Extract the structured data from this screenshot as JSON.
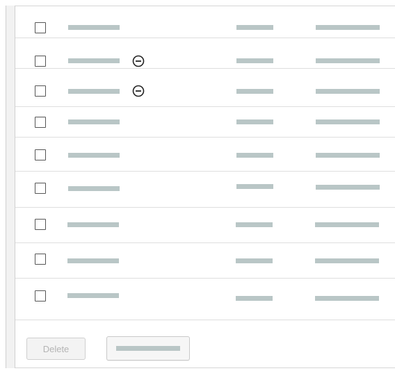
{
  "table": {
    "rows": [
      {
        "checked": false,
        "has_remove_icon": false
      },
      {
        "checked": false,
        "has_remove_icon": true
      },
      {
        "checked": false,
        "has_remove_icon": true
      },
      {
        "checked": false,
        "has_remove_icon": false
      },
      {
        "checked": false,
        "has_remove_icon": false
      },
      {
        "checked": false,
        "has_remove_icon": false
      },
      {
        "checked": false,
        "has_remove_icon": false
      },
      {
        "checked": false,
        "has_remove_icon": false
      },
      {
        "checked": false,
        "has_remove_icon": false
      }
    ],
    "icons": {
      "remove": "minus-circle-icon"
    },
    "colors": {
      "placeholder": "#b9c6c6",
      "divider": "#dedede",
      "checkbox_border": "#555555"
    }
  },
  "footer": {
    "delete_label": "Delete"
  }
}
